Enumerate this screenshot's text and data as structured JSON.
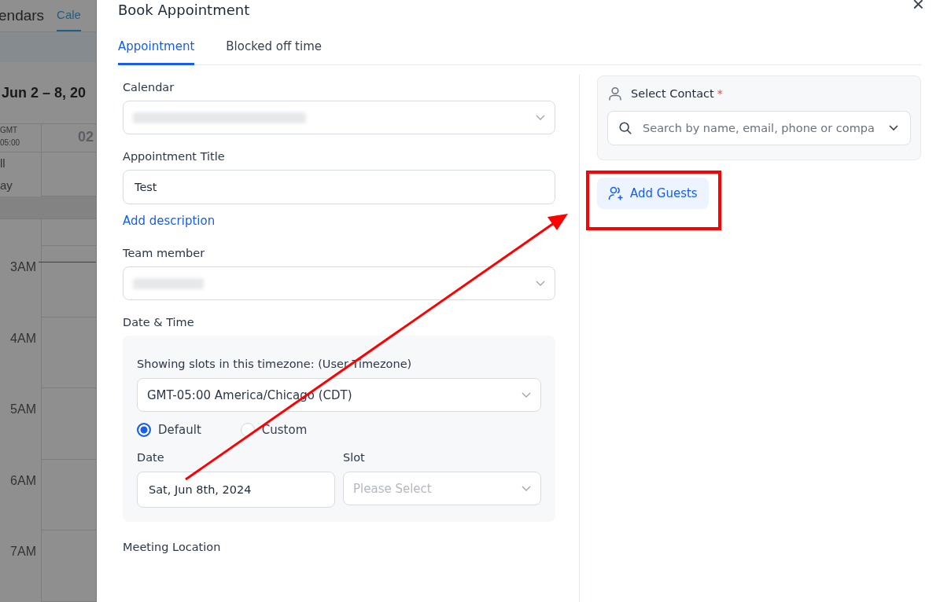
{
  "background": {
    "header_title": "endars",
    "header_tab": "Cale",
    "week_range": "Jun 2 – 8, 20",
    "tz_label": "GMT\n05:00",
    "all_day": "ll\nay",
    "day_number": "02",
    "hours": [
      "3AM",
      "4AM",
      "5AM",
      "6AM",
      "7AM"
    ]
  },
  "modal": {
    "title": "Book Appointment",
    "close": "×",
    "tabs": [
      {
        "label": "Appointment",
        "selected": true
      },
      {
        "label": "Blocked off time",
        "selected": false
      }
    ],
    "calendar": {
      "label": "Calendar",
      "value_blurred": true
    },
    "appointment_title": {
      "label": "Appointment Title",
      "value": "Test"
    },
    "add_description": "Add description",
    "team_member": {
      "label": "Team member",
      "value_blurred": true
    },
    "date_time": {
      "label": "Date & Time",
      "timezone_label": "Showing slots in this timezone: (User Timezone)",
      "timezone": "GMT-05:00 America/Chicago (CDT)",
      "options": [
        {
          "label": "Default",
          "selected": true
        },
        {
          "label": "Custom",
          "selected": false
        }
      ],
      "date_label": "Date",
      "date": "Sat, Jun 8th, 2024",
      "slot_label": "Slot",
      "slot_placeholder": "Please Select"
    },
    "meeting_location": "Meeting Location",
    "contact": {
      "label": "Select Contact",
      "required": "*",
      "placeholder": "Search by name, email, phone or compa"
    },
    "add_guests": "Add Guests"
  }
}
